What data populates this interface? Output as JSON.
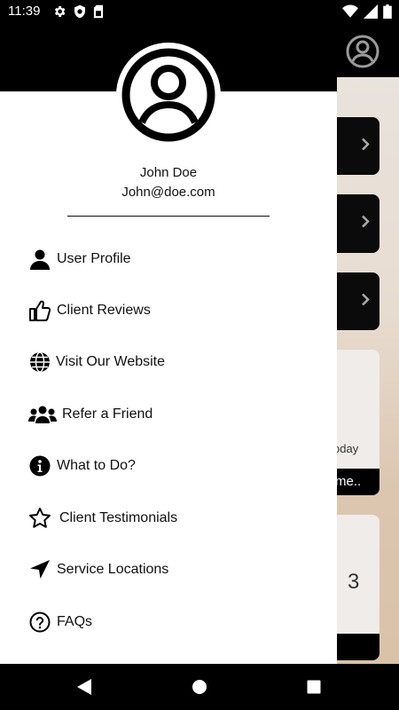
{
  "status_bar": {
    "time": "11:39",
    "icons": [
      "gear-icon",
      "shield-icon",
      "sim-card-icon",
      "wifi-icon",
      "signal-icon",
      "battery-icon"
    ]
  },
  "background_app": {
    "header_icon": "account-circle-icon",
    "tile_1": {
      "label": "oday",
      "footer": "me..",
      "icon": "chevron-right-icon"
    },
    "tile_2": {
      "number": "3",
      "icon": "chevron-right-icon"
    }
  },
  "drawer": {
    "profile": {
      "name": "John Doe",
      "email": "John@doe.com",
      "avatar_icon": "account-circle-icon"
    },
    "menu": [
      {
        "label": "User Profile",
        "icon": "user-icon"
      },
      {
        "label": "Client Reviews",
        "icon": "thumbs-up-icon"
      },
      {
        "label": "Visit Our Website",
        "icon": "globe-icon"
      },
      {
        "label": "Refer a Friend",
        "icon": "users-icon"
      },
      {
        "label": "What to Do?",
        "icon": "info-icon"
      },
      {
        "label": "Client Testimonials",
        "icon": "star-icon"
      },
      {
        "label": "Service Locations",
        "icon": "location-arrow-icon"
      },
      {
        "label": "FAQs",
        "icon": "question-circle-icon"
      }
    ]
  },
  "nav_bar": {
    "buttons": [
      "back-icon",
      "home-icon",
      "recents-icon"
    ]
  },
  "colors": {
    "drawer_bg": "#ffffff",
    "bars_bg": "#000000",
    "text": "#111111"
  }
}
